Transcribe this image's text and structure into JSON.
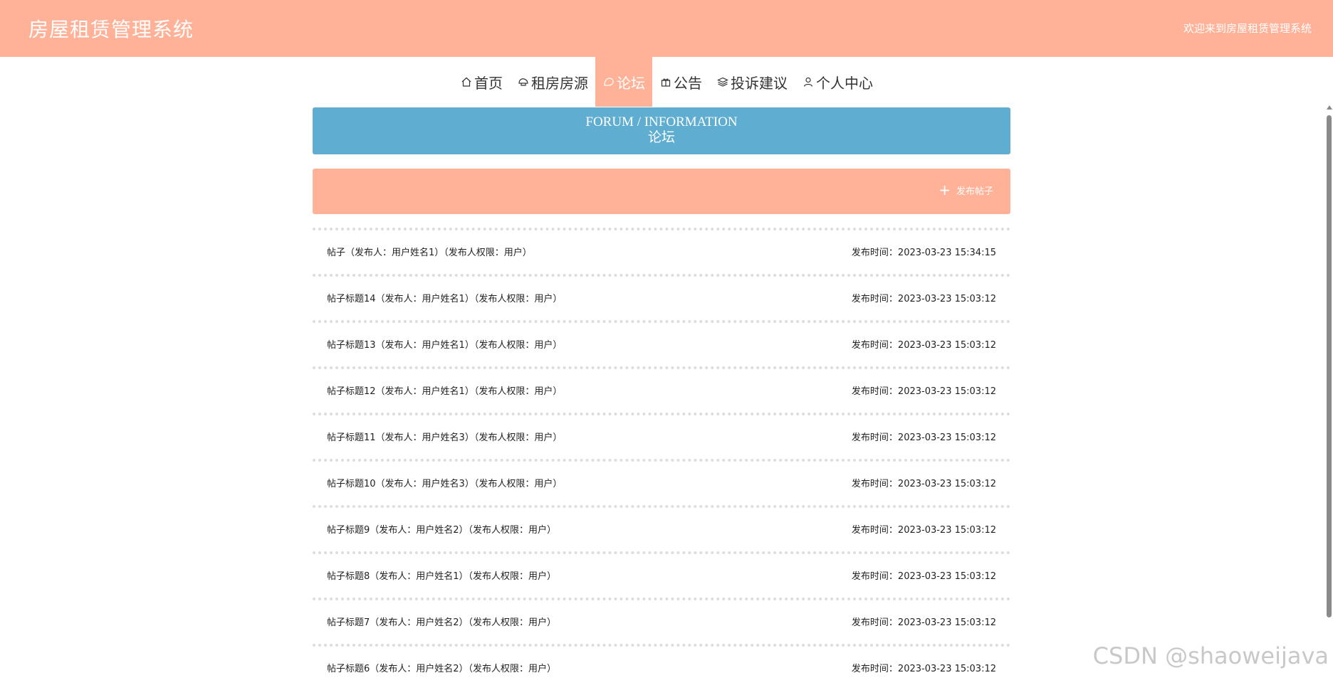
{
  "header": {
    "title": "房屋租赁管理系统",
    "welcome": "欢迎来到房屋租赁管理系统",
    "bg_color": "#ffb297"
  },
  "nav": {
    "items": [
      {
        "icon": "home-icon",
        "label": "首页"
      },
      {
        "icon": "house-rent-icon",
        "label": "租房房源"
      },
      {
        "icon": "forum-icon",
        "label": "论坛"
      },
      {
        "icon": "gift-icon",
        "label": "公告"
      },
      {
        "icon": "layers-icon",
        "label": "投诉建议"
      },
      {
        "icon": "user-icon",
        "label": "个人中心"
      }
    ],
    "active": "论坛"
  },
  "banner": {
    "title_en": "FORUM / INFORMATION",
    "title_cn": "论坛",
    "bg_color": "#5fadd0"
  },
  "actions": {
    "publish_label": "发布帖子"
  },
  "posts": [
    {
      "title": "帖子（发布人：用户姓名1）（发布人权限：用户）",
      "time": "发布时间：2023-03-23 15:34:15"
    },
    {
      "title": "帖子标题14（发布人：用户姓名1）（发布人权限：用户）",
      "time": "发布时间：2023-03-23 15:03:12"
    },
    {
      "title": "帖子标题13（发布人：用户姓名1）（发布人权限：用户）",
      "time": "发布时间：2023-03-23 15:03:12"
    },
    {
      "title": "帖子标题12（发布人：用户姓名1）（发布人权限：用户）",
      "time": "发布时间：2023-03-23 15:03:12"
    },
    {
      "title": "帖子标题11（发布人：用户姓名3）（发布人权限：用户）",
      "time": "发布时间：2023-03-23 15:03:12"
    },
    {
      "title": "帖子标题10（发布人：用户姓名3）（发布人权限：用户）",
      "time": "发布时间：2023-03-23 15:03:12"
    },
    {
      "title": "帖子标题9（发布人：用户姓名2）（发布人权限：用户）",
      "time": "发布时间：2023-03-23 15:03:12"
    },
    {
      "title": "帖子标题8（发布人：用户姓名1）（发布人权限：用户）",
      "time": "发布时间：2023-03-23 15:03:12"
    },
    {
      "title": "帖子标题7（发布人：用户姓名2）（发布人权限：用户）",
      "time": "发布时间：2023-03-23 15:03:12"
    },
    {
      "title": "帖子标题6（发布人：用户姓名2）（发布人权限：用户）",
      "time": "发布时间：2023-03-23 15:03:12"
    }
  ],
  "watermark": "CSDN @shaoweijava"
}
